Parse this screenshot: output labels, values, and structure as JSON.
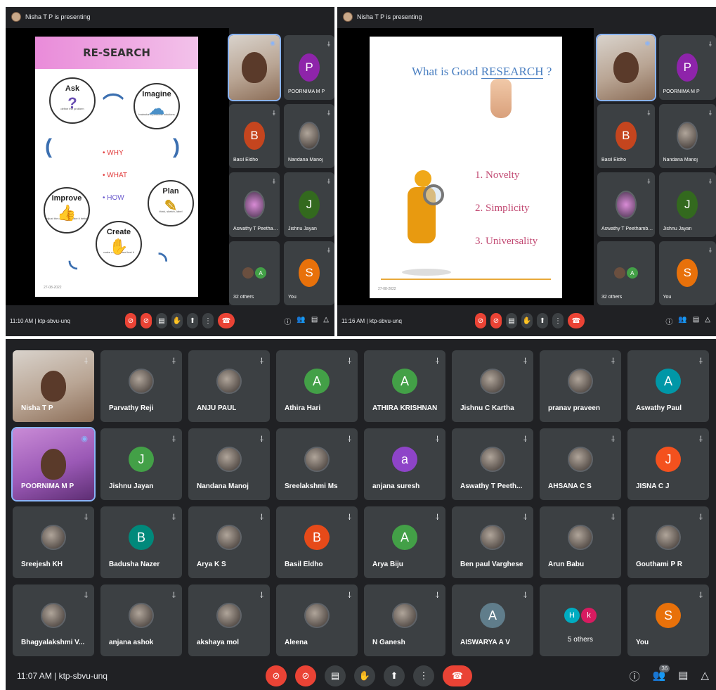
{
  "meeting_a": {
    "presenting_text": "Nisha T P is presenting",
    "meeting_info": "11:10 AM | ktp-sbvu-unq",
    "slide": {
      "title": "RE-SEARCH",
      "steps": [
        {
          "label": "Ask",
          "caption": "define the problem",
          "glyph": "?"
        },
        {
          "label": "Imagine",
          "caption": "brainstorm possible solutions",
          "glyph": "☁"
        },
        {
          "label": "Plan",
          "caption": "think, sketch, label",
          "glyph": "✎"
        },
        {
          "label": "Create",
          "caption": "make a model and test it",
          "glyph": "✋"
        },
        {
          "label": "Improve",
          "caption": "adjust the design to make it better",
          "glyph": "👍"
        }
      ],
      "bullets": [
        "• WHY",
        "• WHAT",
        "• HOW"
      ],
      "footer": "27-08-2022"
    },
    "participants": [
      {
        "name": "Nisha T P",
        "type": "video",
        "speaking": true
      },
      {
        "name": "POORNIMA M P",
        "initial": "P",
        "color": "#8e24aa"
      },
      {
        "name": "Basil Eldho",
        "initial": "B",
        "color": "#c5451e"
      },
      {
        "name": "Nandana Manoj",
        "type": "photo"
      },
      {
        "name": "Aswathy T Peethambaran",
        "type": "photo"
      },
      {
        "name": "Jishnu Jayan",
        "initial": "J",
        "color": "#33691e"
      },
      {
        "name": "32 others",
        "type": "others"
      },
      {
        "name": "You",
        "initial": "S",
        "color": "#e8710a"
      }
    ]
  },
  "meeting_b": {
    "presenting_text": "Nisha T P is presenting",
    "meeting_info": "11:16 AM | ktp-sbvu-unq",
    "slide": {
      "title_prefix": "What is Good ",
      "title_emph": "RESEARCH",
      "title_suffix": " ?",
      "points": [
        "1. Novelty",
        "2. Simplicity",
        "3. Universality"
      ],
      "footer": "27-08-2022"
    },
    "participants": [
      {
        "name": "Nisha T P",
        "type": "video",
        "speaking": true
      },
      {
        "name": "POORNIMA M P",
        "initial": "P",
        "color": "#8e24aa"
      },
      {
        "name": "Basil Eldho",
        "initial": "B",
        "color": "#c5451e"
      },
      {
        "name": "Nandana Manoj",
        "type": "photo"
      },
      {
        "name": "Aswathy T Peethambaran",
        "type": "photo"
      },
      {
        "name": "Jishnu Jayan",
        "initial": "J",
        "color": "#33691e"
      },
      {
        "name": "32 others",
        "type": "others"
      },
      {
        "name": "You",
        "initial": "S",
        "color": "#e8710a"
      }
    ]
  },
  "meeting_c": {
    "meeting_info": "11:07 AM  |  ktp-sbvu-unq",
    "people_count": "36",
    "participants": [
      {
        "name": "Nisha T P",
        "type": "video"
      },
      {
        "name": "Parvathy Reji",
        "type": "photo"
      },
      {
        "name": "ANJU PAUL",
        "type": "photo"
      },
      {
        "name": "Athira Hari",
        "initial": "A",
        "color": "#43a047"
      },
      {
        "name": "ATHIRA KRISHNAN",
        "initial": "A",
        "color": "#43a047"
      },
      {
        "name": "Jishnu C Kartha",
        "type": "photo"
      },
      {
        "name": "pranav praveen",
        "type": "photo"
      },
      {
        "name": "Aswathy Paul",
        "initial": "A",
        "color": "#0097a7"
      },
      {
        "name": "POORNIMA M P",
        "type": "video-purple",
        "speaking": true
      },
      {
        "name": "Jishnu Jayan",
        "initial": "J",
        "color": "#43a047"
      },
      {
        "name": "Nandana Manoj",
        "type": "photo"
      },
      {
        "name": "Sreelakshmi Ms",
        "type": "photo"
      },
      {
        "name": "anjana suresh",
        "initial": "a",
        "color": "#8e44c8"
      },
      {
        "name": "Aswathy T Peeth...",
        "type": "photo"
      },
      {
        "name": "AHSANA C S",
        "type": "photo"
      },
      {
        "name": "JISNA C J",
        "initial": "J",
        "color": "#f4511e"
      },
      {
        "name": "Sreejesh KH",
        "type": "photo"
      },
      {
        "name": "Badusha Nazer",
        "initial": "B",
        "color": "#00897b"
      },
      {
        "name": "Arya K S",
        "type": "photo"
      },
      {
        "name": "Basil Eldho",
        "initial": "B",
        "color": "#e64a19"
      },
      {
        "name": "Arya Biju",
        "initial": "A",
        "color": "#43a047"
      },
      {
        "name": "Ben paul Varghese",
        "type": "photo"
      },
      {
        "name": "Arun Babu",
        "type": "photo"
      },
      {
        "name": "Gouthami P R",
        "type": "photo"
      },
      {
        "name": "Bhagyalakshmi V...",
        "type": "photo"
      },
      {
        "name": "anjana ashok",
        "type": "photo"
      },
      {
        "name": "akshaya mol",
        "type": "photo"
      },
      {
        "name": "Aleena",
        "type": "photo"
      },
      {
        "name": "N Ganesh",
        "type": "photo"
      },
      {
        "name": "AISWARYA A V",
        "initial": "A",
        "color": "#607d8b"
      },
      {
        "name": "5 others",
        "type": "others",
        "chips": [
          "H",
          "k"
        ]
      },
      {
        "name": "You",
        "initial": "S",
        "color": "#e8710a"
      }
    ]
  },
  "icons": {
    "mic_off": "mic-off-icon",
    "cam_off": "camera-off-icon",
    "captions": "captions-icon",
    "raise_hand": "raise-hand-icon",
    "present": "present-icon",
    "more": "more-options-icon",
    "end_call": "end-call-icon",
    "info": "info-icon",
    "people": "people-icon",
    "chat": "chat-icon",
    "activities": "activities-icon"
  }
}
